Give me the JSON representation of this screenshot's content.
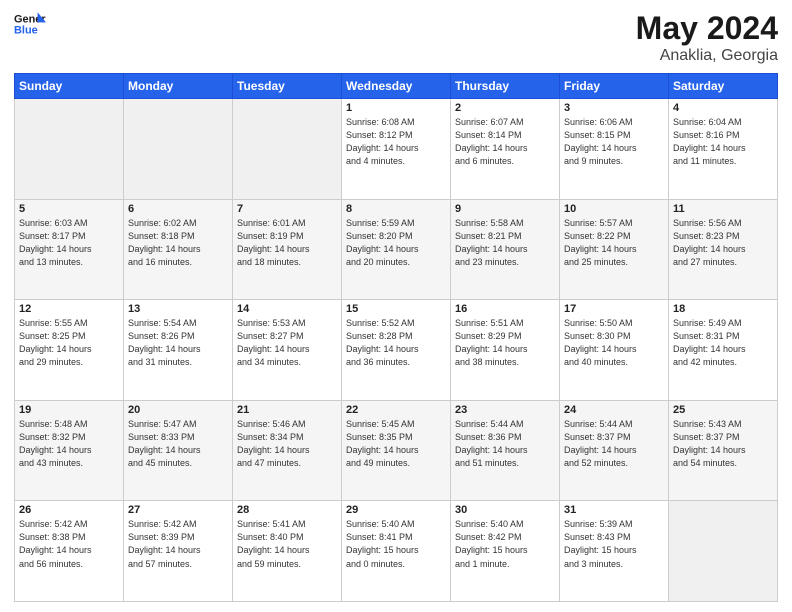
{
  "header": {
    "logo_general": "General",
    "logo_blue": "Blue",
    "month_year": "May 2024",
    "location": "Anaklia, Georgia"
  },
  "days_of_week": [
    "Sunday",
    "Monday",
    "Tuesday",
    "Wednesday",
    "Thursday",
    "Friday",
    "Saturday"
  ],
  "weeks": [
    [
      {
        "num": "",
        "detail": ""
      },
      {
        "num": "",
        "detail": ""
      },
      {
        "num": "",
        "detail": ""
      },
      {
        "num": "1",
        "detail": "Sunrise: 6:08 AM\nSunset: 8:12 PM\nDaylight: 14 hours\nand 4 minutes."
      },
      {
        "num": "2",
        "detail": "Sunrise: 6:07 AM\nSunset: 8:14 PM\nDaylight: 14 hours\nand 6 minutes."
      },
      {
        "num": "3",
        "detail": "Sunrise: 6:06 AM\nSunset: 8:15 PM\nDaylight: 14 hours\nand 9 minutes."
      },
      {
        "num": "4",
        "detail": "Sunrise: 6:04 AM\nSunset: 8:16 PM\nDaylight: 14 hours\nand 11 minutes."
      }
    ],
    [
      {
        "num": "5",
        "detail": "Sunrise: 6:03 AM\nSunset: 8:17 PM\nDaylight: 14 hours\nand 13 minutes."
      },
      {
        "num": "6",
        "detail": "Sunrise: 6:02 AM\nSunset: 8:18 PM\nDaylight: 14 hours\nand 16 minutes."
      },
      {
        "num": "7",
        "detail": "Sunrise: 6:01 AM\nSunset: 8:19 PM\nDaylight: 14 hours\nand 18 minutes."
      },
      {
        "num": "8",
        "detail": "Sunrise: 5:59 AM\nSunset: 8:20 PM\nDaylight: 14 hours\nand 20 minutes."
      },
      {
        "num": "9",
        "detail": "Sunrise: 5:58 AM\nSunset: 8:21 PM\nDaylight: 14 hours\nand 23 minutes."
      },
      {
        "num": "10",
        "detail": "Sunrise: 5:57 AM\nSunset: 8:22 PM\nDaylight: 14 hours\nand 25 minutes."
      },
      {
        "num": "11",
        "detail": "Sunrise: 5:56 AM\nSunset: 8:23 PM\nDaylight: 14 hours\nand 27 minutes."
      }
    ],
    [
      {
        "num": "12",
        "detail": "Sunrise: 5:55 AM\nSunset: 8:25 PM\nDaylight: 14 hours\nand 29 minutes."
      },
      {
        "num": "13",
        "detail": "Sunrise: 5:54 AM\nSunset: 8:26 PM\nDaylight: 14 hours\nand 31 minutes."
      },
      {
        "num": "14",
        "detail": "Sunrise: 5:53 AM\nSunset: 8:27 PM\nDaylight: 14 hours\nand 34 minutes."
      },
      {
        "num": "15",
        "detail": "Sunrise: 5:52 AM\nSunset: 8:28 PM\nDaylight: 14 hours\nand 36 minutes."
      },
      {
        "num": "16",
        "detail": "Sunrise: 5:51 AM\nSunset: 8:29 PM\nDaylight: 14 hours\nand 38 minutes."
      },
      {
        "num": "17",
        "detail": "Sunrise: 5:50 AM\nSunset: 8:30 PM\nDaylight: 14 hours\nand 40 minutes."
      },
      {
        "num": "18",
        "detail": "Sunrise: 5:49 AM\nSunset: 8:31 PM\nDaylight: 14 hours\nand 42 minutes."
      }
    ],
    [
      {
        "num": "19",
        "detail": "Sunrise: 5:48 AM\nSunset: 8:32 PM\nDaylight: 14 hours\nand 43 minutes."
      },
      {
        "num": "20",
        "detail": "Sunrise: 5:47 AM\nSunset: 8:33 PM\nDaylight: 14 hours\nand 45 minutes."
      },
      {
        "num": "21",
        "detail": "Sunrise: 5:46 AM\nSunset: 8:34 PM\nDaylight: 14 hours\nand 47 minutes."
      },
      {
        "num": "22",
        "detail": "Sunrise: 5:45 AM\nSunset: 8:35 PM\nDaylight: 14 hours\nand 49 minutes."
      },
      {
        "num": "23",
        "detail": "Sunrise: 5:44 AM\nSunset: 8:36 PM\nDaylight: 14 hours\nand 51 minutes."
      },
      {
        "num": "24",
        "detail": "Sunrise: 5:44 AM\nSunset: 8:37 PM\nDaylight: 14 hours\nand 52 minutes."
      },
      {
        "num": "25",
        "detail": "Sunrise: 5:43 AM\nSunset: 8:37 PM\nDaylight: 14 hours\nand 54 minutes."
      }
    ],
    [
      {
        "num": "26",
        "detail": "Sunrise: 5:42 AM\nSunset: 8:38 PM\nDaylight: 14 hours\nand 56 minutes."
      },
      {
        "num": "27",
        "detail": "Sunrise: 5:42 AM\nSunset: 8:39 PM\nDaylight: 14 hours\nand 57 minutes."
      },
      {
        "num": "28",
        "detail": "Sunrise: 5:41 AM\nSunset: 8:40 PM\nDaylight: 14 hours\nand 59 minutes."
      },
      {
        "num": "29",
        "detail": "Sunrise: 5:40 AM\nSunset: 8:41 PM\nDaylight: 15 hours\nand 0 minutes."
      },
      {
        "num": "30",
        "detail": "Sunrise: 5:40 AM\nSunset: 8:42 PM\nDaylight: 15 hours\nand 1 minute."
      },
      {
        "num": "31",
        "detail": "Sunrise: 5:39 AM\nSunset: 8:43 PM\nDaylight: 15 hours\nand 3 minutes."
      },
      {
        "num": "",
        "detail": ""
      }
    ]
  ]
}
